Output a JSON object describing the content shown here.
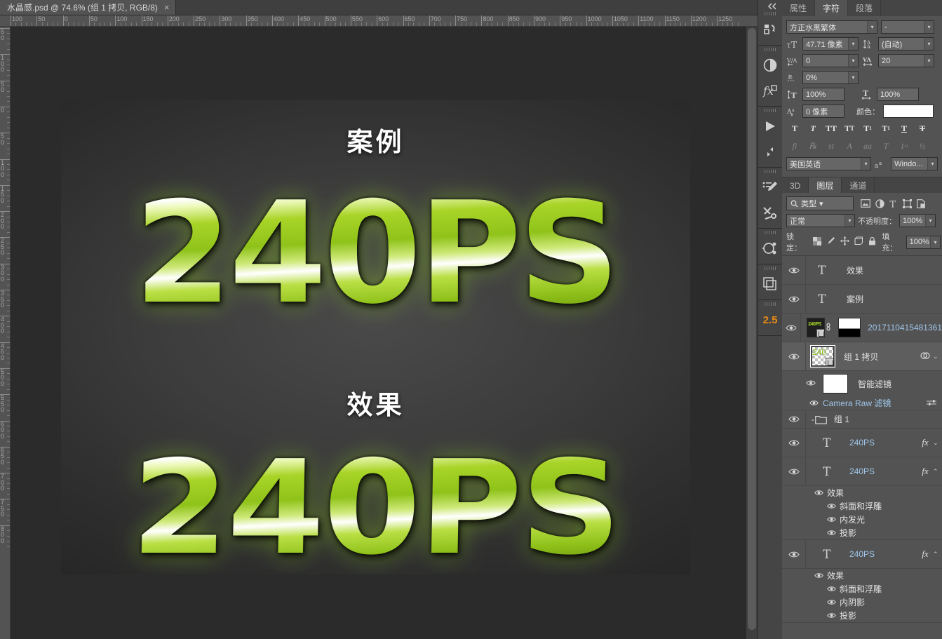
{
  "document": {
    "tab_title": "水晶感.psd @ 74.6% (组 1 拷贝, RGB/8)",
    "close_label": "×",
    "zoom": "74.6%",
    "color_mode": "RGB/8"
  },
  "rulers": {
    "horizontal": [
      "100",
      "50",
      "0",
      "50",
      "100",
      "150",
      "200",
      "250",
      "300",
      "350",
      "400",
      "450",
      "500",
      "550",
      "600",
      "650",
      "700",
      "750",
      "800",
      "850",
      "900",
      "950",
      "1000",
      "1050",
      "1100",
      "1150",
      "1200",
      "1250"
    ],
    "vertical": [
      "50",
      "100",
      "50",
      "0",
      "50",
      "100",
      "150",
      "200",
      "250",
      "300",
      "350",
      "400",
      "450",
      "500",
      "550",
      "600",
      "650",
      "700",
      "750",
      "800"
    ]
  },
  "canvas": {
    "label_top": "案例",
    "label_bottom": "效果",
    "word_top": "240PS",
    "word_bottom": "240PS",
    "art_green": "#9ccd1f",
    "art_highlight": "#ffffff",
    "art_background": "#343434"
  },
  "rail": {
    "items": [
      {
        "name": "history-icon",
        "label": "历史记录"
      },
      {
        "name": "adjustments-icon",
        "label": "调整"
      },
      {
        "name": "styles-fx-icon",
        "label": "样式"
      },
      {
        "name": "timeline-play-icon",
        "label": "时间轴"
      },
      {
        "name": "actions-icon",
        "label": "动作"
      },
      {
        "name": "brush-preset-icon",
        "label": "画笔预设"
      },
      {
        "name": "tool-preset-icon",
        "label": "工具预设"
      },
      {
        "name": "paths-icon",
        "label": "路径"
      },
      {
        "name": "layer-comps-icon",
        "label": "图层复合"
      },
      {
        "name": "version-badge",
        "label": "2.5"
      }
    ],
    "collapse_label": "◄◄"
  },
  "character_panel": {
    "tabs": [
      {
        "label": "属性",
        "active": false
      },
      {
        "label": "字符",
        "active": true
      },
      {
        "label": "段落",
        "active": false
      }
    ],
    "font_family": "方正水黑繁体",
    "font_style": "-",
    "font_size": "47.71 像素",
    "leading": "(自动)",
    "kerning": "0",
    "tracking": "20",
    "vertical_scale_pct": "0%",
    "scale_v": "100%",
    "scale_h": "100%",
    "baseline_shift": "0 像素",
    "color_label": "颜色：",
    "color_value": "#ffffff",
    "style_buttons": [
      "T",
      "T",
      "TT",
      "Tᴛ",
      "T¹",
      "T₁",
      "T",
      "T"
    ],
    "opentype_buttons": [
      "fi",
      "℘",
      "st",
      "A",
      "aa",
      "T",
      "1st",
      "½"
    ],
    "language": "美国英语",
    "anti_alias": "Windo...",
    "aa_icon_label": "aa"
  },
  "layers_panel": {
    "tabs": [
      {
        "label": "3D",
        "active": false
      },
      {
        "label": "图层",
        "active": true
      },
      {
        "label": "通道",
        "active": false
      }
    ],
    "filter_label": "类型",
    "filter_icons": [
      "pixel-filter-icon",
      "adjustment-filter-icon",
      "type-filter-icon",
      "shape-filter-icon",
      "smartobject-filter-icon"
    ],
    "blend_mode": "正常",
    "opacity_label": "不透明度：",
    "opacity_value": "100%",
    "lock_label": "锁定：",
    "lock_icons": [
      "lock-transparent-icon",
      "lock-image-icon",
      "lock-position-icon",
      "lock-artboard-icon",
      "lock-all-icon"
    ],
    "fill_label": "填充：",
    "fill_value": "100%",
    "layers": [
      {
        "kind": "text",
        "name": "效果",
        "visible": true,
        "selected": false,
        "thumb": "type",
        "fx": false
      },
      {
        "kind": "text",
        "name": "案例",
        "visible": true,
        "selected": false,
        "thumb": "type",
        "fx": false
      },
      {
        "kind": "image",
        "name": "2017110415481361",
        "visible": true,
        "selected": false,
        "thumb": "artwork",
        "thumb_text": "240PS",
        "has_mask": true,
        "linked": true,
        "fx": false
      },
      {
        "kind": "smart-object",
        "name": "组 1 拷贝",
        "visible": true,
        "selected": true,
        "thumb": "checker",
        "thumb_text": "240",
        "smart_filter_badge": true,
        "fx": false,
        "children": [
          {
            "type": "smart-filters",
            "name": "智能滤镜",
            "visible": true,
            "thumb": "white"
          },
          {
            "type": "filter",
            "name": "Camera Raw 滤镜",
            "visible": true,
            "has_settings_icon": true
          }
        ]
      },
      {
        "kind": "group",
        "name": "组 1",
        "visible": true,
        "selected": false,
        "expanded": true,
        "thumb": "folder"
      },
      {
        "kind": "text",
        "name": "240PS",
        "visible": true,
        "selected": false,
        "thumb": "type",
        "fx": true,
        "fx_expanded": false
      },
      {
        "kind": "text",
        "name": "240PS",
        "visible": true,
        "selected": false,
        "thumb": "type",
        "fx": true,
        "fx_expanded": true,
        "effects_label": "效果",
        "effects": [
          "斜面和浮雕",
          "内发光",
          "投影"
        ]
      },
      {
        "kind": "text",
        "name": "240PS",
        "visible": true,
        "selected": false,
        "thumb": "type",
        "fx": true,
        "fx_expanded": true,
        "effects_label": "效果",
        "effects": [
          "斜面和浮雕",
          "内阴影",
          "投影"
        ]
      }
    ]
  },
  "icons": {
    "eye": "eye-icon",
    "type_T": "T",
    "fx": "fx",
    "chevron_down": "⌄",
    "search": "search-icon",
    "link": "link-icon"
  }
}
